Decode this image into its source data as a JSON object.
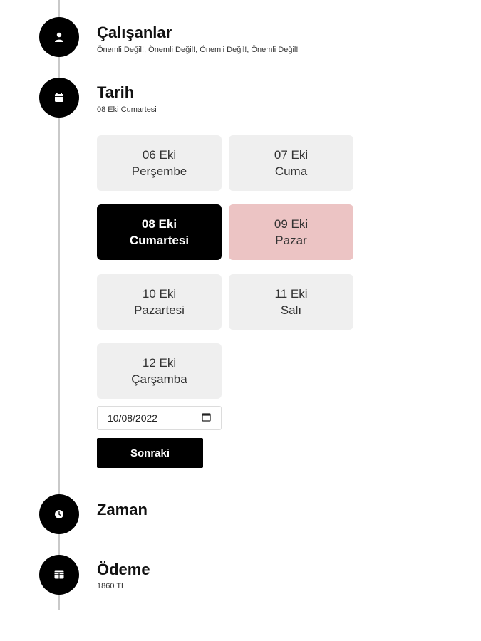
{
  "steps": {
    "employees": {
      "title": "Çalışanlar",
      "subtitle": "Önemli Değil!, Önemli Değil!, Önemli Değil!, Önemli Değil!",
      "icon": "user-icon"
    },
    "date": {
      "title": "Tarih",
      "subtitle": "08 Eki Cumartesi",
      "icon": "calendar-icon"
    },
    "time": {
      "title": "Zaman",
      "icon": "clock-icon"
    },
    "payment": {
      "title": "Ödeme",
      "subtitle": "1860 TL",
      "icon": "table-icon"
    }
  },
  "days": [
    {
      "date": "06 Eki",
      "weekday": "Perşembe",
      "state": "default"
    },
    {
      "date": "07 Eki",
      "weekday": "Cuma",
      "state": "default"
    },
    {
      "date": "08 Eki",
      "weekday": "Cumartesi",
      "state": "selected"
    },
    {
      "date": "09 Eki",
      "weekday": "Pazar",
      "state": "highlighted"
    },
    {
      "date": "10 Eki",
      "weekday": "Pazartesi",
      "state": "default"
    },
    {
      "date": "11 Eki",
      "weekday": "Salı",
      "state": "default"
    },
    {
      "date": "12 Eki",
      "weekday": "Çarşamba",
      "state": "default"
    }
  ],
  "date_input": {
    "value": "10/08/2022",
    "icon": "calendar-picker-icon"
  },
  "next_button": {
    "label": "Sonraki"
  },
  "colors": {
    "accent": "#000000",
    "card": "#efefef",
    "highlight": "#ecc4c4",
    "line": "#c9c9c9"
  }
}
